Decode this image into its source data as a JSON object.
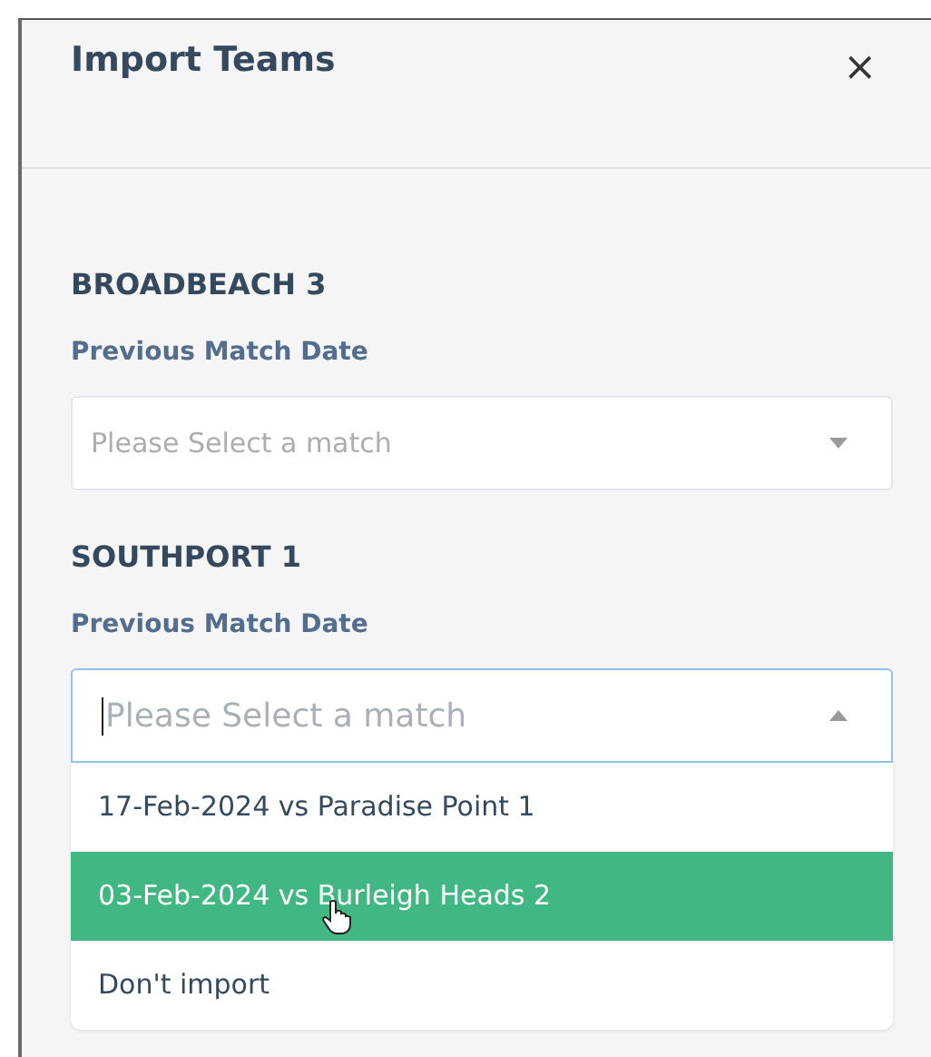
{
  "dialog": {
    "title": "Import Teams",
    "close": "×"
  },
  "teams": [
    {
      "name": "BROADBEACH 3",
      "field_label": "Previous Match Date",
      "select": {
        "placeholder": "Please Select a match",
        "open": false
      }
    },
    {
      "name": "SOUTHPORT 1",
      "field_label": "Previous Match Date",
      "select": {
        "placeholder": "Please Select a match",
        "open": true,
        "options": [
          {
            "label": "17-Feb-2024 vs Paradise Point 1",
            "selected": false
          },
          {
            "label": "03-Feb-2024 vs Burleigh Heads 2",
            "selected": true
          },
          {
            "label": "Don't import",
            "selected": false
          }
        ]
      }
    }
  ]
}
